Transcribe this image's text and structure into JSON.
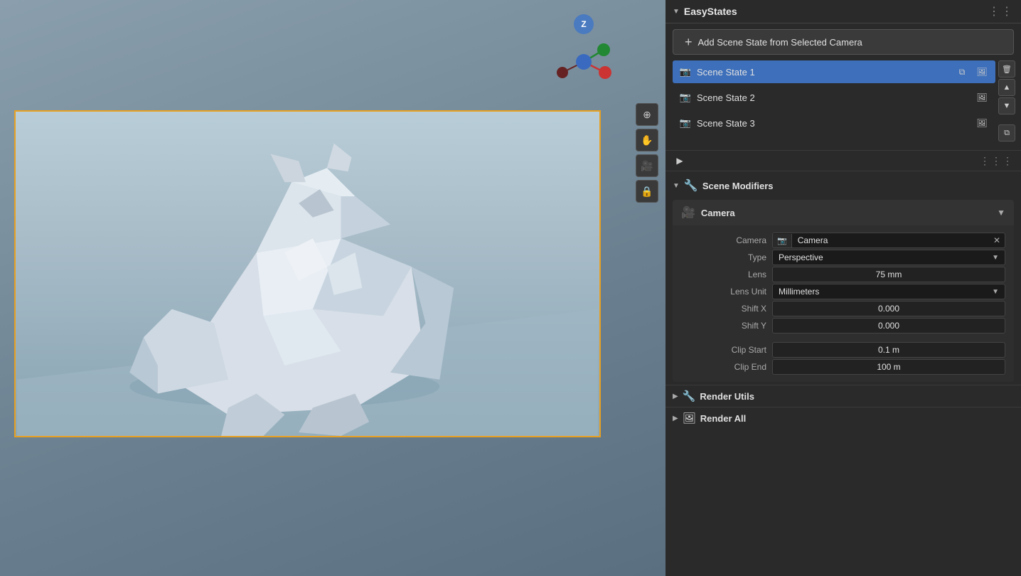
{
  "viewport": {
    "bg_color": "#6a7a8a",
    "gizmo": {
      "z_label": "Z",
      "z_color": "#4a7abf"
    }
  },
  "panel": {
    "title": "EasyStates",
    "dots": "⋮⋮",
    "add_button_label": "Add Scene State from Selected Camera",
    "scene_states": [
      {
        "id": 1,
        "name": "Scene State 1",
        "active": true,
        "has_copy": true,
        "has_render": true
      },
      {
        "id": 2,
        "name": "Scene State 2",
        "active": false,
        "has_copy": false,
        "has_render": true
      },
      {
        "id": 3,
        "name": "Scene State 3",
        "active": false,
        "has_copy": false,
        "has_render": true
      }
    ],
    "side_buttons": {
      "delete": "🗑",
      "up": "▲",
      "down": "▼",
      "copy": "⧉"
    },
    "playback": {
      "play_icon": "▶",
      "dots": "⋮⋮⋮"
    },
    "scene_modifiers": {
      "label": "Scene Modifiers",
      "collapsed": false
    },
    "camera_section": {
      "title": "Camera",
      "fields": {
        "camera_label": "Camera",
        "camera_value": "Camera",
        "camera_icon": "📷",
        "type_label": "Type",
        "type_value": "Perspective",
        "lens_label": "Lens",
        "lens_value": "75 mm",
        "lens_unit_label": "Lens Unit",
        "lens_unit_value": "Millimeters",
        "shift_x_label": "Shift X",
        "shift_x_value": "0.000",
        "shift_y_label": "Shift Y",
        "shift_y_value": "0.000",
        "clip_start_label": "Clip Start",
        "clip_start_value": "0.1 m",
        "clip_end_label": "Clip End",
        "clip_end_value": "100 m"
      }
    },
    "render_utils": {
      "label": "Render Utils"
    },
    "render_all": {
      "label": "Render All"
    }
  },
  "tools": {
    "zoom": "🔍",
    "grab": "✋",
    "camera": "🎥",
    "lock": "🔒"
  },
  "icons": {
    "camera_unicode": "🎥",
    "copy_unicode": "⧉",
    "render_unicode": "🖼",
    "delete_unicode": "🗑",
    "up_unicode": "▲",
    "down_unicode": "▼",
    "wrench_unicode": "🔧",
    "chevron_right": "▶",
    "chevron_down": "▼",
    "x_mark": "✕"
  }
}
